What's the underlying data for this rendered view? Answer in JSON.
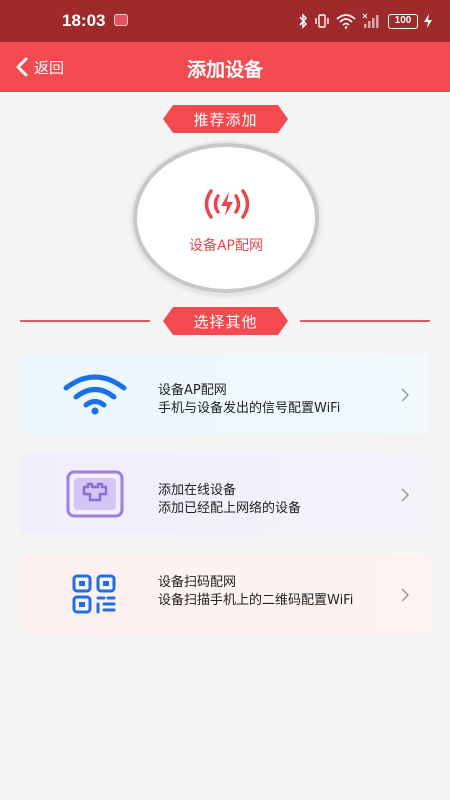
{
  "status_bar": {
    "time": "18:03",
    "battery": "100",
    "icons": [
      "bluetooth-icon",
      "vibrate-icon",
      "wifi-icon",
      "signal-icon",
      "battery-icon",
      "charging-icon"
    ]
  },
  "header": {
    "back_label": "返回",
    "title": "添加设备"
  },
  "recommend": {
    "ribbon": "推荐添加",
    "label": "设备AP配网"
  },
  "others": {
    "ribbon": "选择其他"
  },
  "options": [
    {
      "title": "设备AP配网",
      "desc": "手机与设备发出的信号配置WiFi",
      "icon": "wifi-icon"
    },
    {
      "title": "添加在线设备",
      "desc": "添加已经配上网络的设备",
      "icon": "router-icon"
    },
    {
      "title": "设备扫码配网",
      "desc": "设备扫描手机上的二维码配置WiFi",
      "icon": "qr-code-icon"
    }
  ],
  "colors": {
    "status_bar": "#9e2a2b",
    "header": "#f24a4e",
    "accent": "#e6484b"
  }
}
